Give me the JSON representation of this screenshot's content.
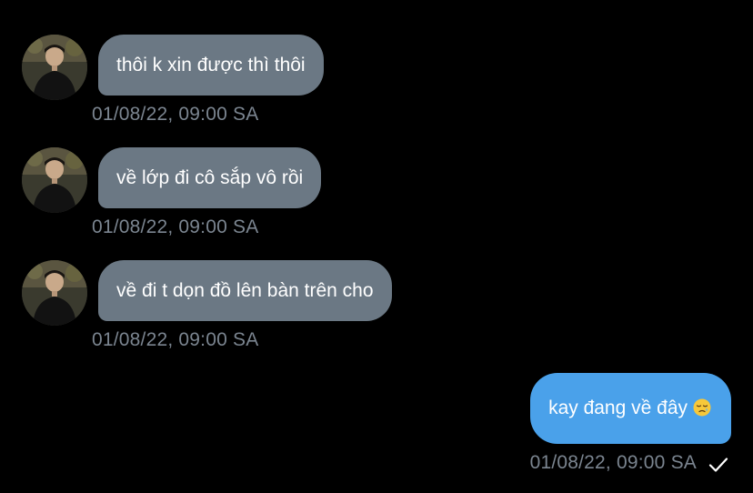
{
  "conversation": {
    "incoming": [
      {
        "text": "thôi k xin được thì thôi",
        "timestamp": "01/08/22, 09:00 SA",
        "avatar": "profile-photo"
      },
      {
        "text": "về lớp đi cô sắp vô rồi",
        "timestamp": "01/08/22, 09:00 SA",
        "avatar": "profile-photo"
      },
      {
        "text": "về đi t dọn đồ lên bàn trên cho",
        "timestamp": "01/08/22, 09:00 SA",
        "avatar": "profile-photo"
      }
    ],
    "outgoing": [
      {
        "text": "kay đang về đây",
        "emoji": "sleepy-face-emoji",
        "timestamp": "01/08/22, 09:00 SA",
        "status_icon": "checkmark-icon"
      }
    ]
  },
  "colors": {
    "background": "#000000",
    "incoming_bubble": "#6b7884",
    "outgoing_bubble": "#4aa1ea",
    "timestamp": "#7b8590",
    "text": "#ffffff"
  }
}
